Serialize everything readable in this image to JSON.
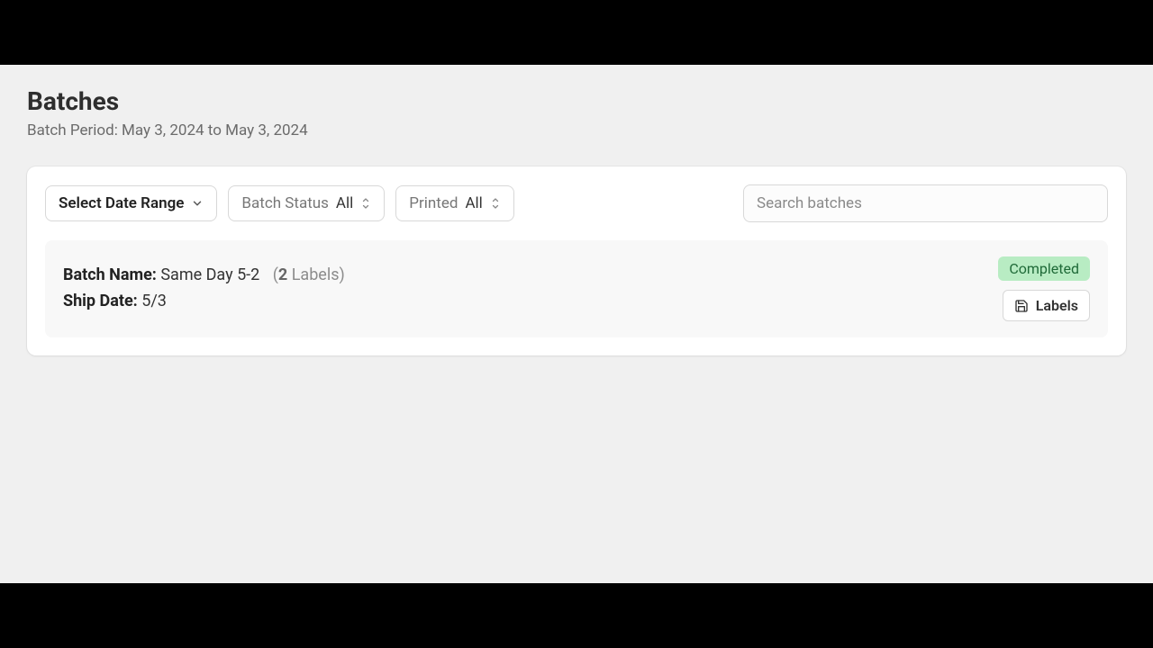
{
  "header": {
    "title": "Batches",
    "subtitle": "Batch Period: May 3, 2024 to May 3, 2024"
  },
  "toolbar": {
    "date_range_label": "Select Date Range",
    "status_filter_label": "Batch Status",
    "status_filter_value": "All",
    "printed_filter_label": "Printed",
    "printed_filter_value": "All",
    "search_placeholder": "Search batches"
  },
  "batches": [
    {
      "name_label": "Batch Name:",
      "name_value": "Same Day 5-2",
      "labels_count_prefix": "(",
      "labels_count_num": "2",
      "labels_count_suffix": " Labels)",
      "ship_date_label": "Ship Date:",
      "ship_date_value": "5/3",
      "status": "Completed",
      "labels_button": "Labels"
    }
  ]
}
